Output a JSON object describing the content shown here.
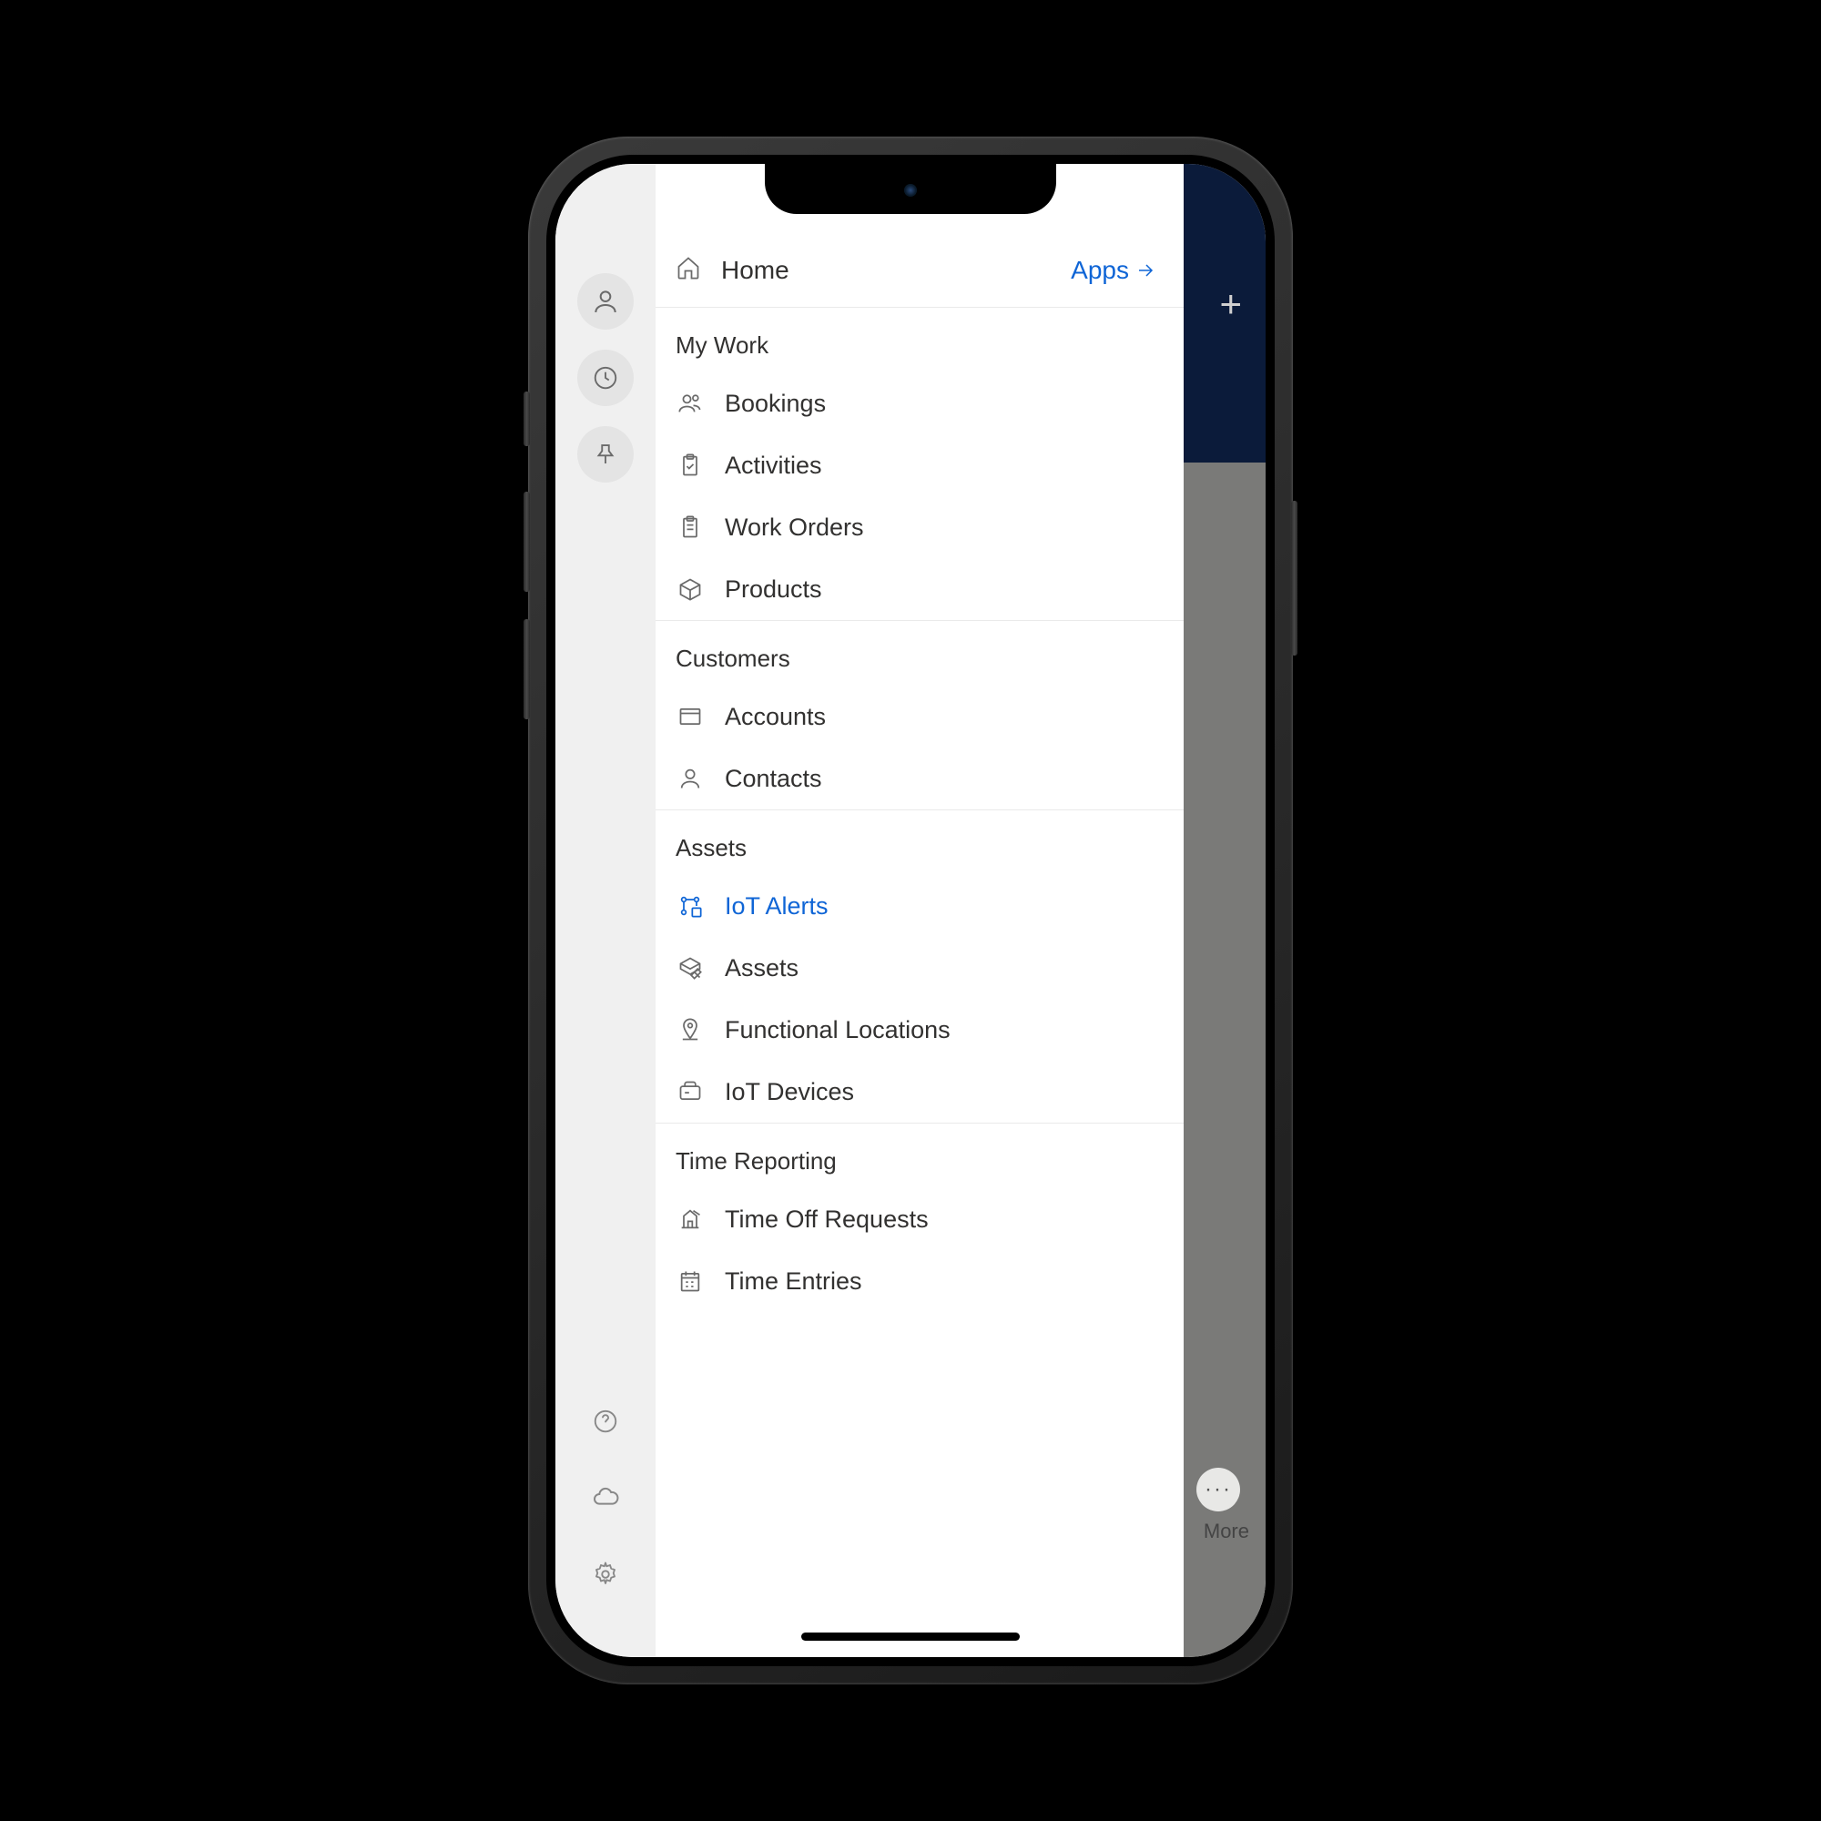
{
  "header": {
    "home_label": "Home",
    "apps_label": "Apps"
  },
  "sections": [
    {
      "title": "My Work",
      "items": [
        {
          "icon": "people-icon",
          "label": "Bookings",
          "active": false
        },
        {
          "icon": "clipboard-check-icon",
          "label": "Activities",
          "active": false
        },
        {
          "icon": "clipboard-icon",
          "label": "Work Orders",
          "active": false
        },
        {
          "icon": "box-icon",
          "label": "Products",
          "active": false
        }
      ]
    },
    {
      "title": "Customers",
      "items": [
        {
          "icon": "folder-icon",
          "label": "Accounts",
          "active": false
        },
        {
          "icon": "person-icon",
          "label": "Contacts",
          "active": false
        }
      ]
    },
    {
      "title": "Assets",
      "items": [
        {
          "icon": "iot-alert-icon",
          "label": "IoT Alerts",
          "active": true
        },
        {
          "icon": "box-edit-icon",
          "label": "Assets",
          "active": false
        },
        {
          "icon": "location-pin-icon",
          "label": "Functional Locations",
          "active": false
        },
        {
          "icon": "device-icon",
          "label": "IoT Devices",
          "active": false
        }
      ]
    },
    {
      "title": "Time Reporting",
      "items": [
        {
          "icon": "time-off-icon",
          "label": "Time Off Requests",
          "active": false
        },
        {
          "icon": "calendar-icon",
          "label": "Time Entries",
          "active": false
        }
      ]
    }
  ],
  "backdrop": {
    "plus_label": "+",
    "more_label": "More",
    "dots_label": "···"
  }
}
